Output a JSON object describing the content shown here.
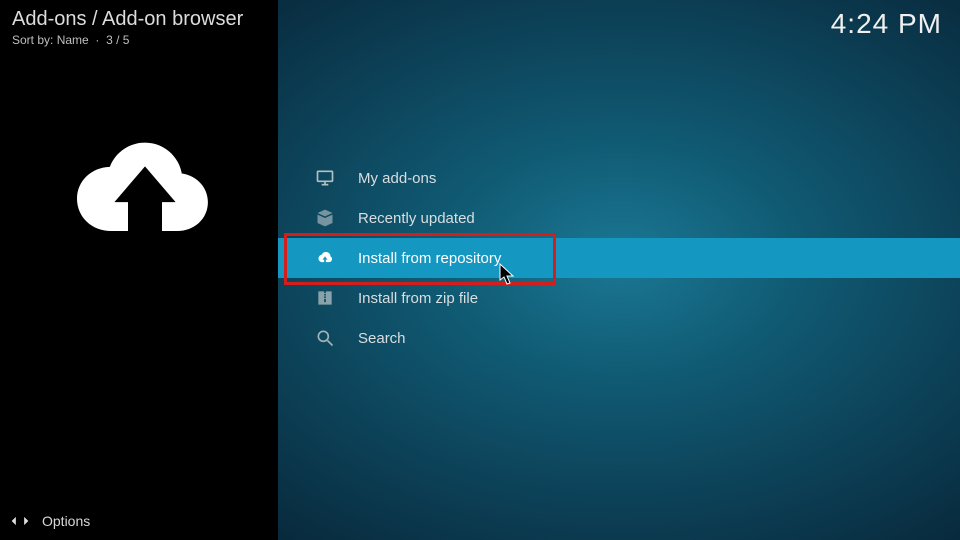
{
  "header": {
    "breadcrumb": "Add-ons / Add-on browser",
    "sort_label": "Sort by:",
    "sort_value": "Name",
    "position": "3 / 5",
    "clock": "4:24 PM"
  },
  "menu": {
    "items": [
      {
        "label": "My add-ons",
        "icon": "monitor-icon",
        "selected": false
      },
      {
        "label": "Recently updated",
        "icon": "open-box-icon",
        "selected": false
      },
      {
        "label": "Install from repository",
        "icon": "cloud-down-icon",
        "selected": true
      },
      {
        "label": "Install from zip file",
        "icon": "zip-box-icon",
        "selected": false
      },
      {
        "label": "Search",
        "icon": "search-icon",
        "selected": false
      }
    ]
  },
  "footer": {
    "options_label": "Options"
  },
  "annotation": {
    "highlight_index": 2,
    "cursor_on_index": 2
  }
}
